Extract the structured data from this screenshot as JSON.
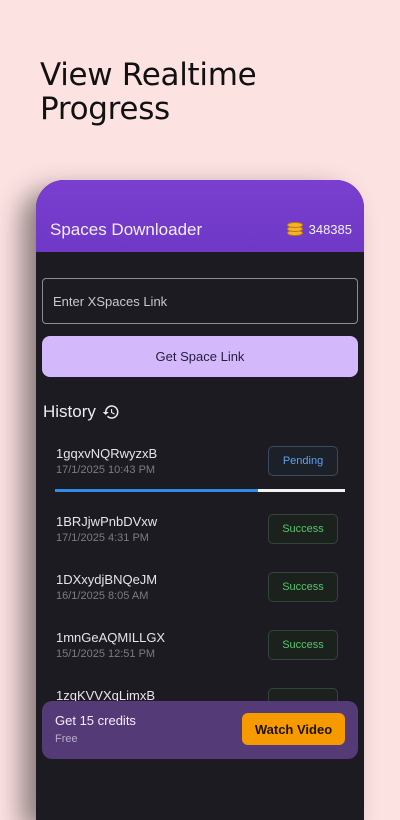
{
  "promo": {
    "line1": "View Realtime",
    "line2": "Progress"
  },
  "appbar": {
    "title": "Spaces Downloader",
    "credits": "348385",
    "credits_icon": "coins-icon"
  },
  "input": {
    "placeholder": "Enter XSpaces Link"
  },
  "get_button": {
    "label": "Get Space Link"
  },
  "history": {
    "title": "History",
    "icon": "history-icon",
    "items": [
      {
        "name": "1gqxvNQRwyzxB",
        "date": "17/1/2025 10:43 PM",
        "status": "Pending",
        "progress": 0.7
      },
      {
        "name": "1BRJjwPnbDVxw",
        "date": "17/1/2025 4:31 PM",
        "status": "Success"
      },
      {
        "name": "1DXxydjBNQeJM",
        "date": "16/1/2025 8:05 AM",
        "status": "Success"
      },
      {
        "name": "1mnGeAQMILLGX",
        "date": "15/1/2025 12:51 PM",
        "status": "Success"
      },
      {
        "name": "1zqKVVXqLimxB",
        "date": "",
        "status": ""
      }
    ]
  },
  "banner": {
    "title": "Get 15 credits",
    "subtitle": "Free",
    "button": "Watch Video"
  },
  "colors": {
    "accent": "#7a3fd0",
    "button_light": "#d3b9fb",
    "pending": "#5ea1ef",
    "success": "#56c46a",
    "watch": "#f79a00"
  }
}
